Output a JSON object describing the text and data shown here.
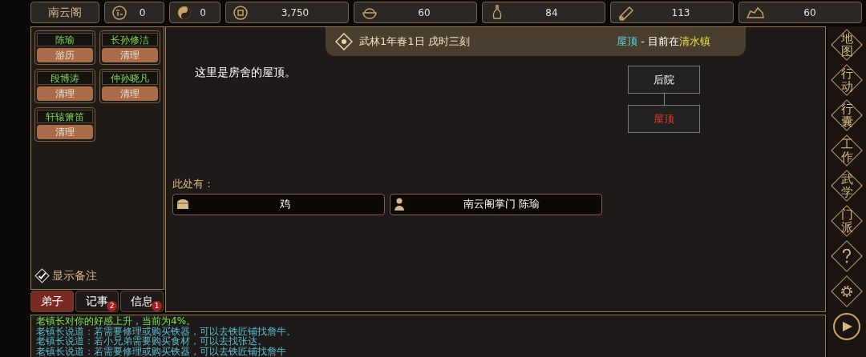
{
  "top_bar": {
    "sect_name": "南云阁",
    "resources": [
      {
        "kind": "seal",
        "value": "0"
      },
      {
        "kind": "yinyang",
        "value": "0"
      },
      {
        "kind": "coin",
        "value": "3,750"
      },
      {
        "kind": "food",
        "value": "60"
      },
      {
        "kind": "gourd",
        "value": "84"
      },
      {
        "kind": "wood",
        "value": "113"
      },
      {
        "kind": "ore",
        "value": "60"
      }
    ]
  },
  "disciples": [
    {
      "name": "陈瑜",
      "task": "游历"
    },
    {
      "name": "长孙修洁",
      "task": "清理"
    },
    {
      "name": "段博涛",
      "task": "清理"
    },
    {
      "name": "仲孙晓凡",
      "task": "清理"
    },
    {
      "name": "轩辕箫笛",
      "task": "清理"
    }
  ],
  "show_notes": {
    "label": "显示备注",
    "checked": true
  },
  "left_tabs": [
    {
      "label": "弟子",
      "selected": true
    },
    {
      "label": "记事",
      "selected": false,
      "badge": "2"
    },
    {
      "label": "信息",
      "selected": false,
      "badge": "1"
    }
  ],
  "header": {
    "date": "武林1年春1日 戌时三刻",
    "location": "屋顶",
    "separator": " - 目前在",
    "town": "清水镇"
  },
  "description": "这里是房舍的屋顶。",
  "map": {
    "nodes": [
      {
        "label": "后院",
        "selected": false
      },
      {
        "label": "屋顶",
        "selected": true
      }
    ]
  },
  "here": {
    "title": "此处有：",
    "items": [
      {
        "kind": "item",
        "label": "鸡"
      },
      {
        "kind": "person",
        "label": "南云阁掌门 陈瑜"
      }
    ]
  },
  "side_menu": [
    {
      "kind": "text",
      "label": "地图"
    },
    {
      "kind": "text",
      "label": "行动"
    },
    {
      "kind": "text",
      "label": "行囊"
    },
    {
      "kind": "text",
      "label": "工作"
    },
    {
      "kind": "text",
      "label": "武学"
    },
    {
      "kind": "text",
      "label": "门派"
    },
    {
      "kind": "help"
    },
    {
      "kind": "settings"
    },
    {
      "kind": "play"
    }
  ],
  "log": [
    {
      "kind": "event",
      "text": "老镇长对你的好感上升，当前为4%。"
    },
    {
      "kind": "speech",
      "text": "老镇长说道：若需要修理或购买铁器，可以去铁匠铺找詹牛。"
    },
    {
      "kind": "speech",
      "text": "老镇长说道：若小兄弟需要购买食材，可以去找张达。"
    },
    {
      "kind": "speech",
      "text": "老镇长说道：若需要修理或购买铁器，可以去铁匠铺找詹牛"
    }
  ]
}
